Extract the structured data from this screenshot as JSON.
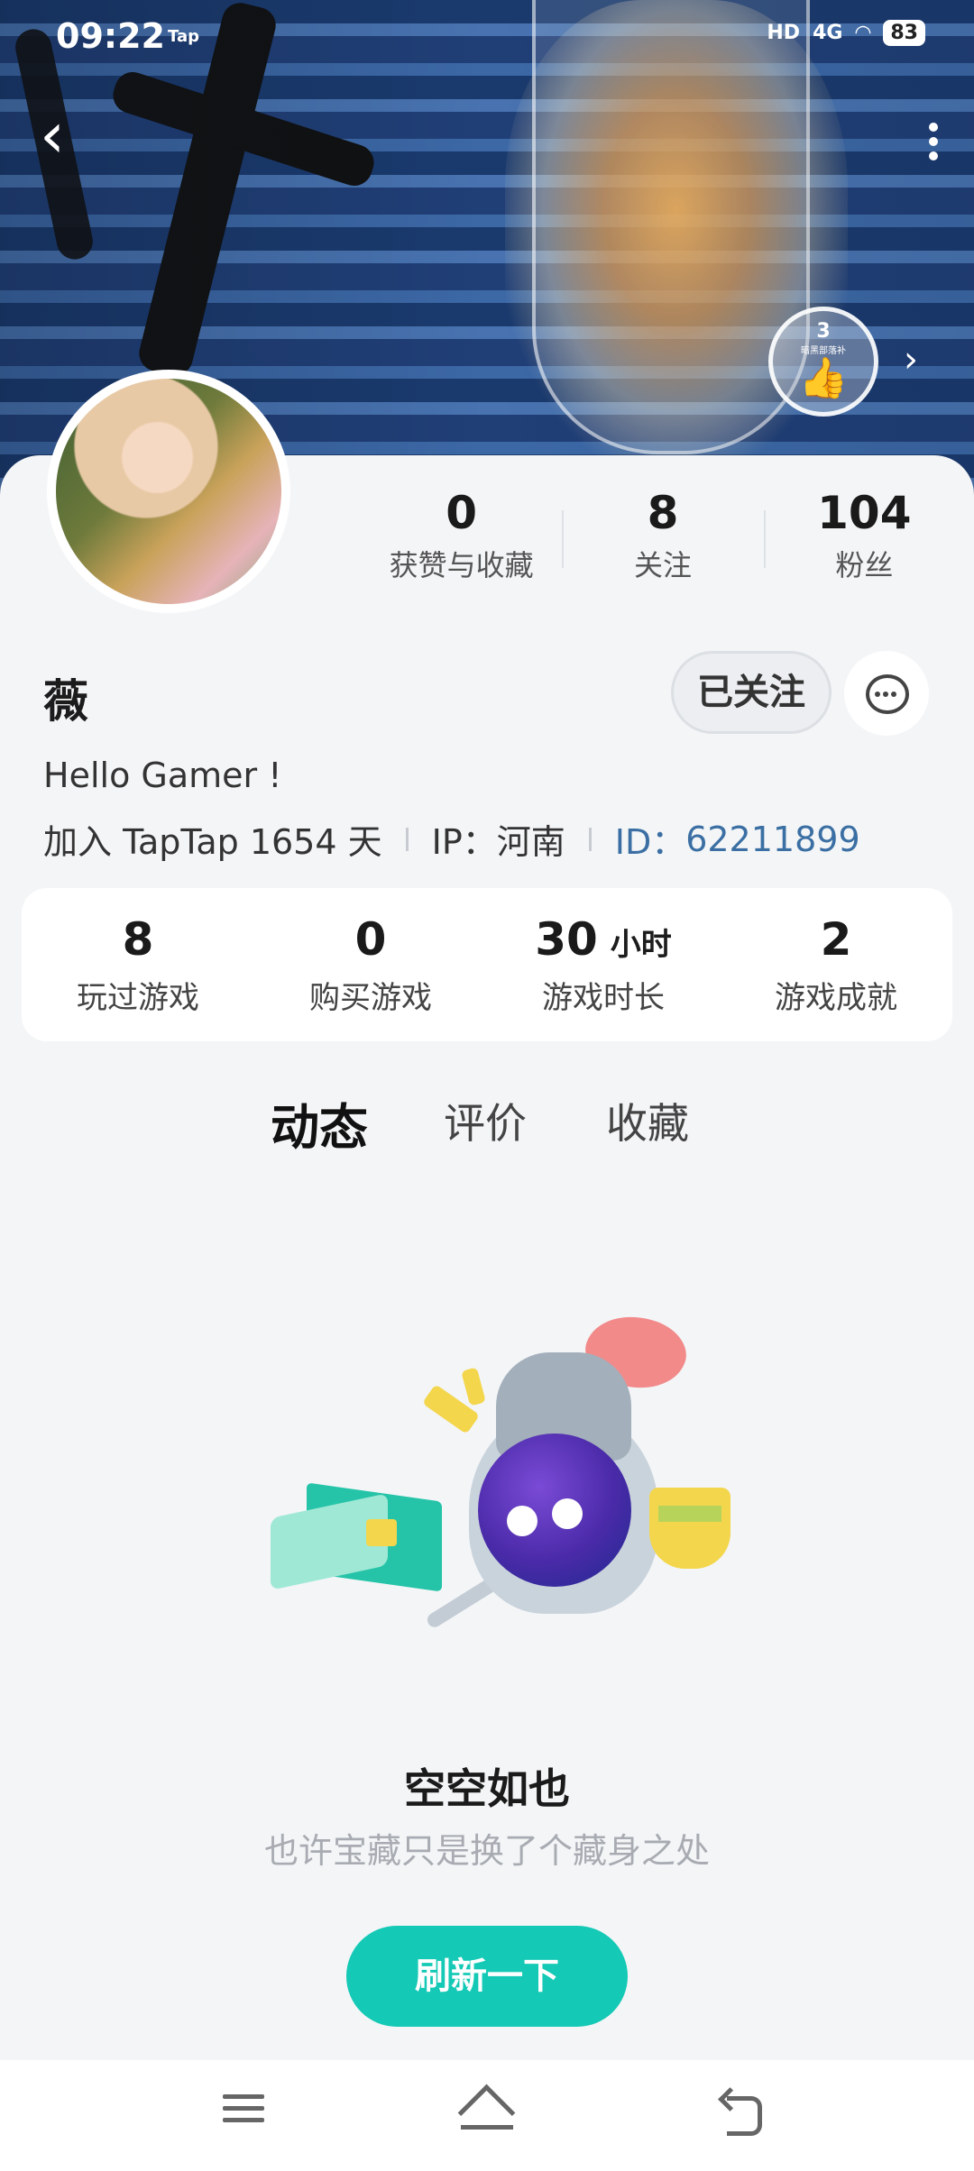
{
  "status_bar": {
    "time": "09:22",
    "app_tag": "Tap",
    "signal": "4G",
    "hd": "HD",
    "battery": "83"
  },
  "banner": {
    "badge_number": "3",
    "badge_text": "暗黑部落补"
  },
  "profile": {
    "name": "薇",
    "bio": "Hello Gamer !",
    "joined": "加入 TapTap 1654 天",
    "ip": "IP：河南",
    "id_label": "ID：",
    "id_value": "62211899",
    "follow_label": "已关注"
  },
  "stats": [
    {
      "value": "0",
      "label": "获赞与收藏"
    },
    {
      "value": "8",
      "label": "关注"
    },
    {
      "value": "104",
      "label": "粉丝"
    }
  ],
  "games": [
    {
      "value": "8",
      "unit": "",
      "label": "玩过游戏"
    },
    {
      "value": "0",
      "unit": "",
      "label": "购买游戏"
    },
    {
      "value": "30",
      "unit": "小时",
      "label": "游戏时长"
    },
    {
      "value": "2",
      "unit": "",
      "label": "游戏成就"
    }
  ],
  "tabs": [
    {
      "label": "动态",
      "active": true
    },
    {
      "label": "评价",
      "active": false
    },
    {
      "label": "收藏",
      "active": false
    }
  ],
  "empty": {
    "title": "空空如也",
    "subtitle": "也许宝藏只是换了个藏身之处",
    "button": "刷新一下"
  },
  "colors": {
    "accent": "#14c9b5",
    "id_blue": "#3b6fa3"
  }
}
